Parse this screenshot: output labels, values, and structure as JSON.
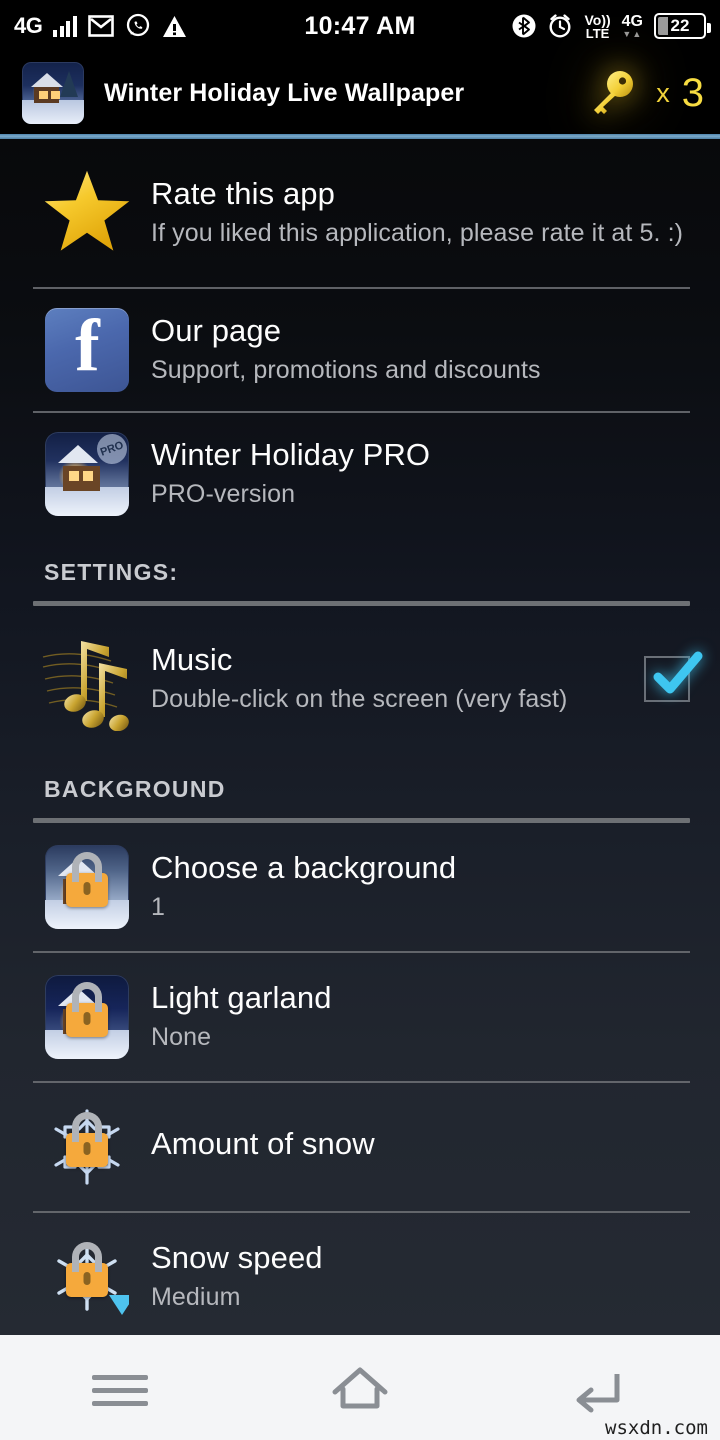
{
  "statusbar": {
    "network_label": "4G",
    "icons_left": [
      "signal-bars-icon",
      "email-icon",
      "whatsapp-icon",
      "warning-icon"
    ],
    "clock": "10:47 AM",
    "bluetooth": "bluetooth-icon",
    "alarm": "alarm-icon",
    "volte_top": "Vo))",
    "volte_bottom": "LTE",
    "data_network": "4G",
    "data_arrows": "▼▲",
    "battery_level": "22"
  },
  "appbar": {
    "title": "Winter Holiday Live Wallpaper",
    "thumb_name": "app-icon-winter-cabin",
    "key_icon": "key-icon",
    "key_multiplier": "x",
    "key_count": "3",
    "accent_color": "#7aa9c9",
    "key_color": "#f2d53c"
  },
  "list": [
    {
      "id": "rate-this-app",
      "icon": "star-icon",
      "title": "Rate this app",
      "subtitle": "If you liked this application, please rate it at 5. :)",
      "locked": false,
      "checkbox": null
    },
    {
      "id": "our-page",
      "icon": "facebook-icon",
      "title": "Our page",
      "subtitle": "Support, promotions and discounts",
      "locked": false,
      "checkbox": null
    },
    {
      "id": "winter-holiday-pro",
      "icon": "pro-app-icon",
      "title": "Winter Holiday PRO",
      "subtitle": "PRO-version",
      "locked": false,
      "checkbox": null
    }
  ],
  "sections": [
    {
      "id": "settings",
      "header": "SETTINGS:",
      "rows": [
        {
          "id": "music",
          "icon": "music-notes-icon",
          "title": "Music",
          "subtitle": "Double-click on the screen (very fast)",
          "locked": false,
          "checkbox": true,
          "checkbox_color": "#3ec6f0"
        }
      ]
    },
    {
      "id": "background",
      "header": "BACKGROUND",
      "rows": [
        {
          "id": "choose-a-background",
          "icon": "background-preview-icon",
          "title": "Choose a background",
          "subtitle": "1",
          "locked": true,
          "checkbox": null
        },
        {
          "id": "light-garland",
          "icon": "garland-preview-icon",
          "title": "Light garland",
          "subtitle": "None",
          "locked": true,
          "checkbox": null
        },
        {
          "id": "amount-of-snow",
          "icon": "snowflake-icon",
          "title": "Amount of snow",
          "subtitle": "",
          "locked": true,
          "checkbox": null
        },
        {
          "id": "snow-speed",
          "icon": "snowflake-speed-icon",
          "title": "Snow speed",
          "subtitle": "Medium",
          "locked": true,
          "checkbox": null,
          "dropdown_arrow": true
        }
      ]
    }
  ],
  "navbar": {
    "menu": "menu-icon",
    "home": "home-icon",
    "back": "back-icon"
  },
  "watermark": "wsxdn.com"
}
